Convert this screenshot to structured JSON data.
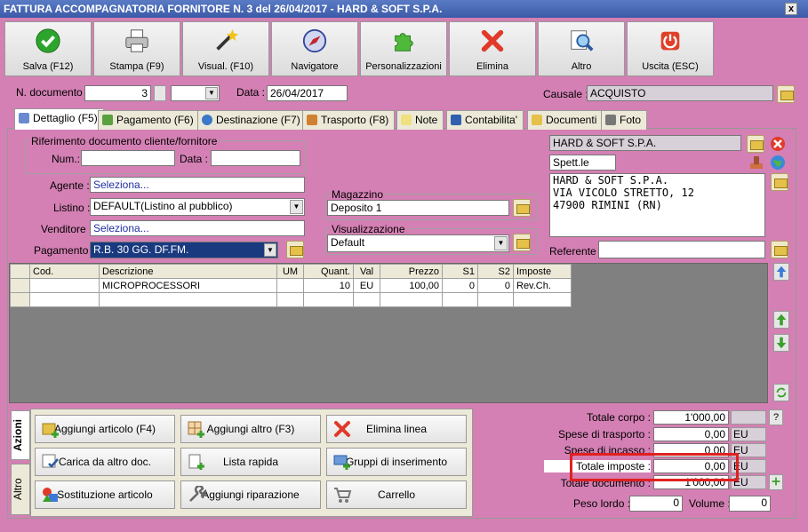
{
  "window": {
    "title": "FATTURA ACCOMPAGNATORIA FORNITORE N. 3 del 26/04/2017 - HARD & SOFT S.P.A.",
    "close": "x"
  },
  "toolbar": [
    {
      "label": "Salva (F12)",
      "icon": "check-icon"
    },
    {
      "label": "Stampa (F9)",
      "icon": "printer-icon"
    },
    {
      "label": "Visual. (F10)",
      "icon": "magic-wand-icon"
    },
    {
      "label": "Navigatore",
      "icon": "compass-icon"
    },
    {
      "label": "Personalizzazioni",
      "icon": "puzzle-icon"
    },
    {
      "label": "Elimina",
      "icon": "delete-x-icon"
    },
    {
      "label": "Altro",
      "icon": "search-icon"
    },
    {
      "label": "Uscita (ESC)",
      "icon": "power-icon"
    }
  ],
  "header": {
    "ndoc_label": "N. documento :",
    "ndoc_value": "3",
    "data_label": "Data :",
    "data_value": "26/04/2017",
    "causale_label": "Causale :",
    "causale_value": "ACQUISTO"
  },
  "tabs": [
    {
      "label": "Dettaglio (F5)",
      "active": true
    },
    {
      "label": "Pagamento (F6)"
    },
    {
      "label": "Destinazione (F7)"
    },
    {
      "label": "Trasporto (F8)"
    },
    {
      "label": "Note"
    },
    {
      "label": "Contabilita'"
    },
    {
      "label": "Documenti"
    },
    {
      "label": "Foto"
    }
  ],
  "riferimento": {
    "title": "Riferimento documento cliente/fornitore",
    "num_label": "Num.:",
    "num_value": "",
    "data_label": "Data :",
    "data_value": ""
  },
  "form": {
    "agente_label": "Agente :",
    "agente_value": "Seleziona...",
    "listino_label": "Listino :",
    "listino_value": "DEFAULT(Listino al pubblico)",
    "venditore_label": "Venditore :",
    "venditore_value": "Seleziona...",
    "pagamento_label": "Pagamento :",
    "pagamento_value": "R.B. 30 GG. DF.FM."
  },
  "magazzino": {
    "title": "Magazzino",
    "value": "Deposito 1"
  },
  "visualizzazione": {
    "title": "Visualizzazione",
    "value": "Default"
  },
  "fornitore": {
    "name": "HARD & SOFT S.P.A.",
    "spett": "Spett.le",
    "address_lines": [
      "HARD & SOFT S.P.A.",
      "VIA VICOLO STRETTO, 12",
      "47900 RIMINI (RN)"
    ],
    "referente_label": "Referente",
    "referente_value": ""
  },
  "grid": {
    "columns": [
      "Cod.",
      "Descrizione",
      "UM",
      "Quant.",
      "Val",
      "Prezzo",
      "S1",
      "S2",
      "Imposte"
    ],
    "rows": [
      [
        "",
        "MICROPROCESSORI",
        "",
        "10",
        "EU",
        "100,00",
        "0",
        "0",
        "Rev.Ch."
      ]
    ]
  },
  "side_tabs": {
    "azioni": "Azioni",
    "altro": "Altro"
  },
  "actions": [
    {
      "label": "Aggiungi articolo (F4)"
    },
    {
      "label": "Aggiungi altro (F3)"
    },
    {
      "label": "Elimina linea"
    },
    {
      "label": "Carica da altro doc."
    },
    {
      "label": "Lista rapida"
    },
    {
      "label": "Gruppi di inserimento"
    },
    {
      "label": "Sostituzione articolo"
    },
    {
      "label": "Aggiungi riparazione"
    },
    {
      "label": "Carrello"
    }
  ],
  "totals": {
    "corpo_label": "Totale corpo :",
    "corpo_value": "1'000,00",
    "trasporto_label": "Spese di trasporto :",
    "trasporto_value": "0,00",
    "trasporto_cur": "EU",
    "incasso_label": "Spese di incasso :",
    "incasso_value": "0,00",
    "incasso_cur": "EU",
    "imposte_label": "Totale imposte :",
    "imposte_value": "0,00",
    "imposte_cur": "EU",
    "documento_label": "Totale documento :",
    "documento_value": "1'000,00",
    "documento_cur": "EU",
    "peso_label": "Peso lordo :",
    "peso_value": "0",
    "volume_label": "Volume :",
    "volume_value": "0",
    "help": "?"
  }
}
